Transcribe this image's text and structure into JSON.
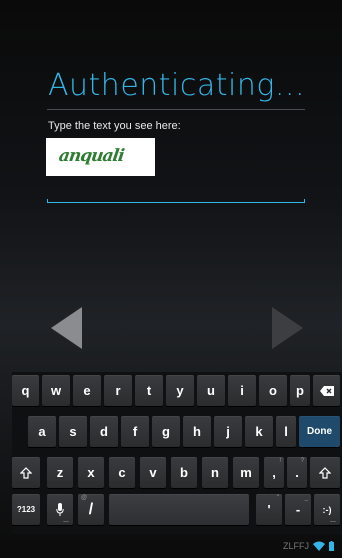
{
  "title": "Authenticating...",
  "prompt": "Type the text you see here:",
  "captcha_text": "anquali",
  "answer_value": "",
  "keyboard": {
    "row1": [
      "q",
      "w",
      "e",
      "r",
      "t",
      "y",
      "u",
      "i",
      "o",
      "p"
    ],
    "row2": [
      "a",
      "s",
      "d",
      "f",
      "g",
      "h",
      "j",
      "k",
      "l"
    ],
    "row3": [
      "z",
      "x",
      "c",
      "v",
      "b",
      "n",
      "m",
      ",",
      "."
    ],
    "done_label": "Done",
    "symbols_label": "?123",
    "apostrophe": "'",
    "dash": "-",
    "smiley": ":-)",
    "slash": "/",
    "slash_hint": "@",
    "comma_hint": "!",
    "period_hint": "?",
    "apostrophe_hint": "\"",
    "dash_hint": "_"
  },
  "status": {
    "text": "ZLFFJ"
  },
  "colors": {
    "accent": "#33b5e5",
    "done_key": "#1f4a6b",
    "battery": "#33b5e5"
  },
  "icons": {
    "back": "triangle-left-icon",
    "next": "triangle-right-icon",
    "backspace": "backspace-icon",
    "shift": "shift-icon",
    "mic": "microphone-icon",
    "wifi": "wifi-icon",
    "battery": "battery-icon"
  }
}
